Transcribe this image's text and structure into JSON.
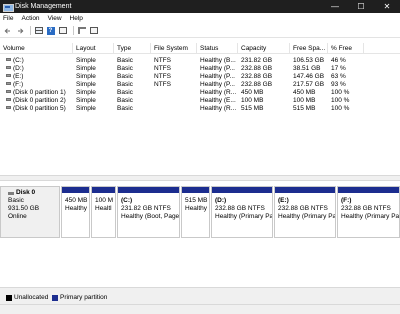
{
  "window": {
    "title": "Disk Management",
    "minimize": "—",
    "maximize": "☐",
    "close": "✕"
  },
  "menu": [
    "File",
    "Action",
    "View",
    "Help"
  ],
  "volume_list": {
    "columns": [
      "Volume",
      "Layout",
      "Type",
      "File System",
      "Status",
      "Capacity",
      "Free Spa...",
      "% Free"
    ],
    "rows": [
      [
        "(C:)",
        "Simple",
        "Basic",
        "NTFS",
        "Healthy (B...",
        "231.82 GB",
        "106.53 GB",
        "46 %"
      ],
      [
        "(D:)",
        "Simple",
        "Basic",
        "NTFS",
        "Healthy (P...",
        "232.88 GB",
        "38.51 GB",
        "17 %"
      ],
      [
        "(E:)",
        "Simple",
        "Basic",
        "NTFS",
        "Healthy (P...",
        "232.88 GB",
        "147.46 GB",
        "63 %"
      ],
      [
        "(F:)",
        "Simple",
        "Basic",
        "NTFS",
        "Healthy (P...",
        "232.88 GB",
        "217.57 GB",
        "93 %"
      ],
      [
        "(Disk 0 partition 1)",
        "Simple",
        "Basic",
        "",
        "Healthy (R...",
        "450 MB",
        "450 MB",
        "100 %"
      ],
      [
        "(Disk 0 partition 2)",
        "Simple",
        "Basic",
        "",
        "Healthy (E...",
        "100 MB",
        "100 MB",
        "100 %"
      ],
      [
        "(Disk 0 partition 5)",
        "Simple",
        "Basic",
        "",
        "Healthy (R...",
        "515 MB",
        "515 MB",
        "100 %"
      ]
    ]
  },
  "disk": {
    "name": "Disk 0",
    "type": "Basic",
    "size": "931.50 GB",
    "status": "Online",
    "partitions": [
      {
        "name": "",
        "line1": "450 MB",
        "line2": "Healthy"
      },
      {
        "name": "",
        "line1": "100 M",
        "line2": "Healtl"
      },
      {
        "name": "(C:)",
        "line1": "231.82 GB NTFS",
        "line2": "Healthy (Boot, Page"
      },
      {
        "name": "",
        "line1": "515 MB",
        "line2": "Healthy"
      },
      {
        "name": "(D:)",
        "line1": "232.88 GB NTFS",
        "line2": "Healthy (Primary Pa"
      },
      {
        "name": "(E:)",
        "line1": "232.88 GB NTFS",
        "line2": "Healthy (Primary Pa"
      },
      {
        "name": "(F:)",
        "line1": "232.88 GB NTFS",
        "line2": "Healthy (Primary Pa"
      }
    ]
  },
  "legend": {
    "unallocated": {
      "label": "Unallocated",
      "color": "#000000"
    },
    "primary": {
      "label": "Primary partition",
      "color": "#1c2d8f"
    }
  },
  "icons": {
    "back": "back-arrow-icon",
    "forward": "forward-arrow-icon",
    "volume_list_view": "list-view-icon",
    "help": "help-icon",
    "properties": "properties-icon",
    "settings": "settings-icon",
    "rescan": "rescan-icon"
  },
  "colors": {
    "titlebar": "#1f1f1f",
    "partition_bar": "#1c2d8f"
  }
}
